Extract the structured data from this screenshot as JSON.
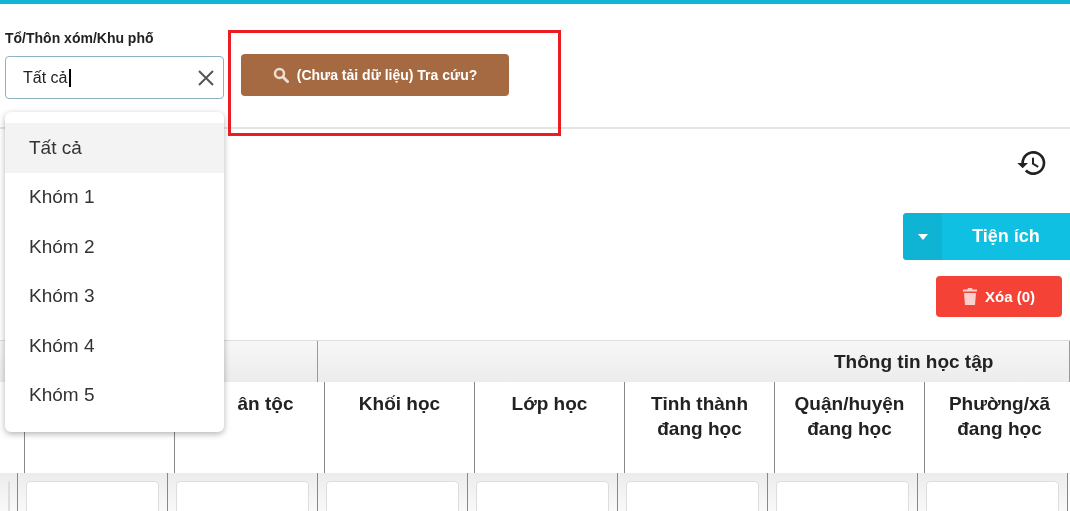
{
  "filter": {
    "label": "Tổ/Thôn xóm/Khu phố",
    "value": "Tất cả",
    "expanded": true,
    "options": [
      {
        "label": "Tất cả",
        "selected": true
      },
      {
        "label": "Khóm 1",
        "selected": false
      },
      {
        "label": "Khóm 2",
        "selected": false
      },
      {
        "label": "Khóm 3",
        "selected": false
      },
      {
        "label": "Khóm 4",
        "selected": false
      },
      {
        "label": "Khóm 5",
        "selected": false
      }
    ]
  },
  "search_button": {
    "label": "(Chưa tải dữ liệu) Tra cứu?"
  },
  "toolbar": {
    "utilities_button": "Tiện ích",
    "delete_button": "Xóa (0)"
  },
  "table": {
    "group_header": "Thông tin học tập",
    "columns": [
      {
        "label": "ân tộc"
      },
      {
        "label": "Khối học"
      },
      {
        "label": "Lớp học"
      },
      {
        "label": "Tỉnh thành đang học"
      },
      {
        "label": "Quận/huyện đang học"
      },
      {
        "label": "Phường/xã đang học"
      }
    ]
  }
}
